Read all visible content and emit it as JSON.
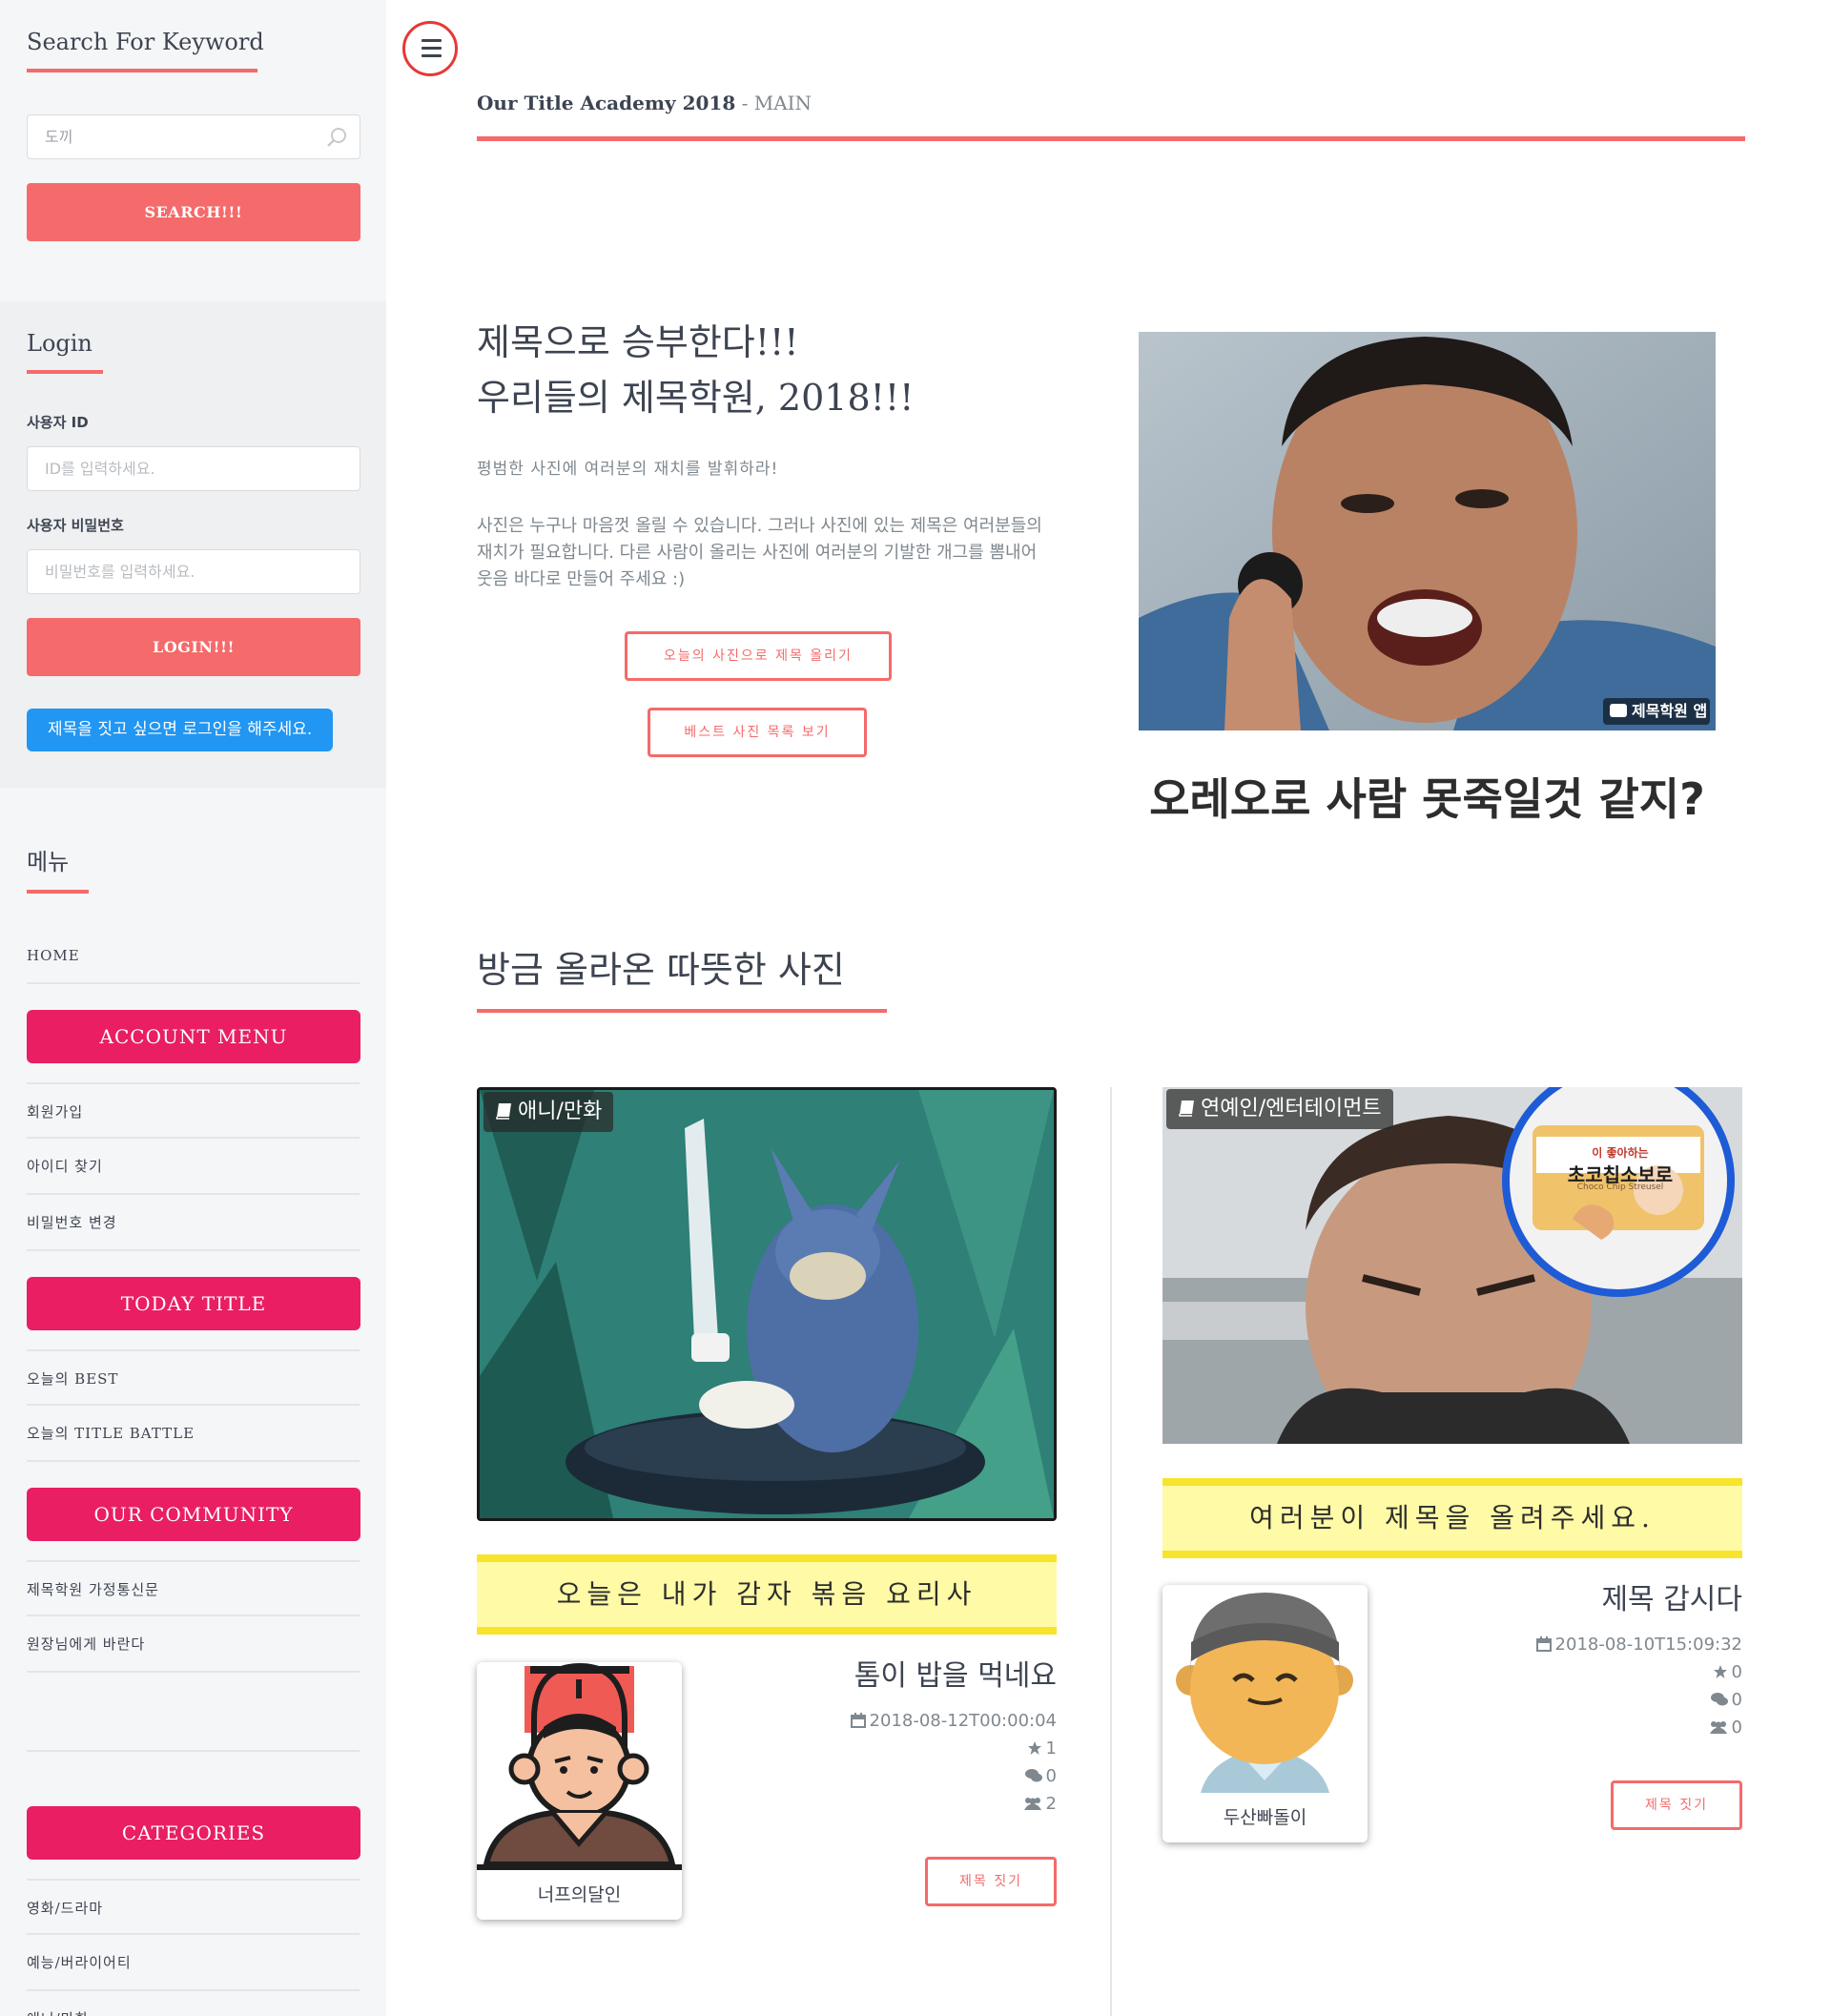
{
  "sidebar": {
    "search": {
      "heading": "Search For Keyword",
      "input_value": "도끼",
      "button": "SEARCH!!!"
    },
    "login": {
      "heading": "Login",
      "id_label": "사용자 ID",
      "id_placeholder": "ID를 입력하세요.",
      "pw_label": "사용자 비밀번호",
      "pw_placeholder": "비밀번호를 입력하세요.",
      "button": "LOGIN!!!",
      "notice": "제목을 짓고 싶으면 로그인을 해주세요."
    },
    "menu": {
      "heading": "메뉴",
      "home": "HOME",
      "account_menu": "ACCOUNT MENU",
      "signup": "회원가입",
      "find_id": "아이디 찾기",
      "change_pw": "비밀번호 변경",
      "today_title": "TODAY TITLE",
      "today_best": "오늘의 BEST",
      "today_battle": "오늘의 TITLE BATTLE",
      "our_community": "OUR COMMUNITY",
      "newsletter": "제목학원 가정통신문",
      "to_director": "원장님에게 바란다",
      "categories": "CATEGORIES",
      "cat_movie": "영화/드라마",
      "cat_variety": "예능/버라이어티",
      "cat_anime": "애니/만화"
    }
  },
  "header": {
    "title": "Our Title Academy 2018",
    "separator": " - ",
    "subtitle": "MAIN"
  },
  "banner": {
    "title_line1": "제목으로 승부한다!!!",
    "title_line2": "우리들의 제목학원, 2018!!!",
    "subtitle": "평범한 사진에 여러분의 재치를 발휘하라!",
    "body": "사진은 누구나 마음껏 올릴 수 있습니다. 그러나 사진에 있는 제목은 여러분들의 재치가 필요합니다. 다른 사람이 올리는 사진에 여러분의 기발한 개그를 뽐내어 웃음 바다로 만들어 주세요 :)",
    "button_upload": "오늘의 사진으로 제목 올리기",
    "button_best": "베스트 사진 목록 보기",
    "hero_watermark": "제목학원 앱",
    "hero_caption": "오레오로 사람 못죽일것 같지?"
  },
  "section": {
    "title": "방금 올라온 따뜻한 사진"
  },
  "posts": [
    {
      "category": "애니/만화",
      "caption": "오늘은 내가 감자 볶음 요리사",
      "author": "너프의달인",
      "title": "톰이 밥을 먹네요",
      "date": "2018-08-12T00:00:04",
      "stars": "1",
      "comments": "0",
      "likes": "2",
      "button": "제목 짓기"
    },
    {
      "category": "연예인/엔터테이먼트",
      "caption": "여러분이 제목을 올려주세요.",
      "author": "두산빠돌이",
      "title": "제목 갑시다",
      "date": "2018-08-10T15:09:32",
      "stars": "0",
      "comments": "0",
      "likes": "0",
      "button": "제목 짓기",
      "sticker_line1": "이 좋아하는",
      "sticker_line2": "초코칩소보로",
      "sticker_line3": "Choco Chip Streusel"
    }
  ],
  "colors": {
    "accent_red": "#f56a6a",
    "menu_pink": "#e91e63",
    "notice_blue": "#2196f3",
    "caption_yellow": "#fffaa6"
  },
  "icons": [
    "search-icon",
    "hamburger-icon",
    "book-icon",
    "calendar-icon",
    "star-icon",
    "comments-icon",
    "users-icon"
  ]
}
